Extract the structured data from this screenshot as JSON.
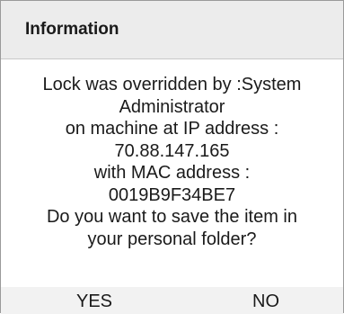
{
  "dialog": {
    "title": "Information",
    "message_lines": [
      "Lock was overridden by :System",
      "Administrator",
      "on machine at IP address :",
      "70.88.147.165",
      "with MAC address :",
      "0019B9F34BE7",
      "Do you want to save the item in",
      "your personal folder?"
    ],
    "buttons": {
      "yes_label": "YES",
      "no_label": "NO"
    }
  }
}
